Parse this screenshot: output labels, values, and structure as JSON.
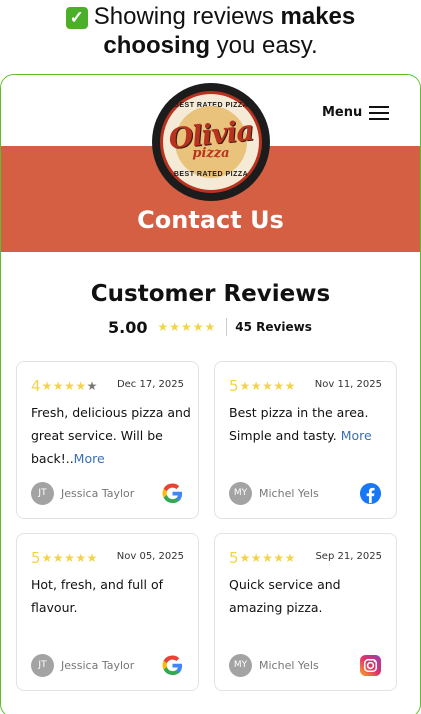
{
  "headline": {
    "check": "✓",
    "line1_a": "Showing reviews ",
    "line1_b": "makes",
    "line2_a": "choosing",
    "line2_b": " you easy."
  },
  "site": {
    "logo_top": "BEST RATED PIZZA",
    "logo_brand": "Olivia",
    "logo_sub": "pizza",
    "logo_bottom": "BEST RATED PIZZA",
    "menu_label": "Menu",
    "banner_title": "Contact Us",
    "brand_color": "#d45f43",
    "frame_color": "#5cbf2a"
  },
  "reviews": {
    "title": "Customer Reviews",
    "score": "5.00",
    "stars": "★★★★★",
    "count": "45 Reviews",
    "items": [
      {
        "rating": "4",
        "stars_on": "★★★★",
        "stars_off": "★",
        "date": "Dec 17, 2025",
        "text": "Fresh, delicious pizza and great service. Will be back!..",
        "more": "More",
        "initials": "JT",
        "author": "Jessica Taylor",
        "source": "google-icon"
      },
      {
        "rating": "5",
        "stars_on": "★★★★★",
        "stars_off": "",
        "date": "Nov 11, 2025",
        "text": "Best pizza in the area. Simple and tasty. ",
        "more": "More",
        "initials": "MY",
        "author": "Michel Yels",
        "source": "facebook-icon"
      },
      {
        "rating": "5",
        "stars_on": "★★★★★",
        "stars_off": "",
        "date": "Nov 05, 2025",
        "text": "Hot, fresh, and full of flavour.",
        "more": "",
        "initials": "JT",
        "author": "Jessica Taylor",
        "source": "google-icon"
      },
      {
        "rating": "5",
        "stars_on": "★★★★★",
        "stars_off": "",
        "date": "Sep 21, 2025",
        "text": "Quick service and amazing pizza.",
        "more": "",
        "initials": "MY",
        "author": "Michel Yels",
        "source": "instagram-icon"
      }
    ]
  }
}
